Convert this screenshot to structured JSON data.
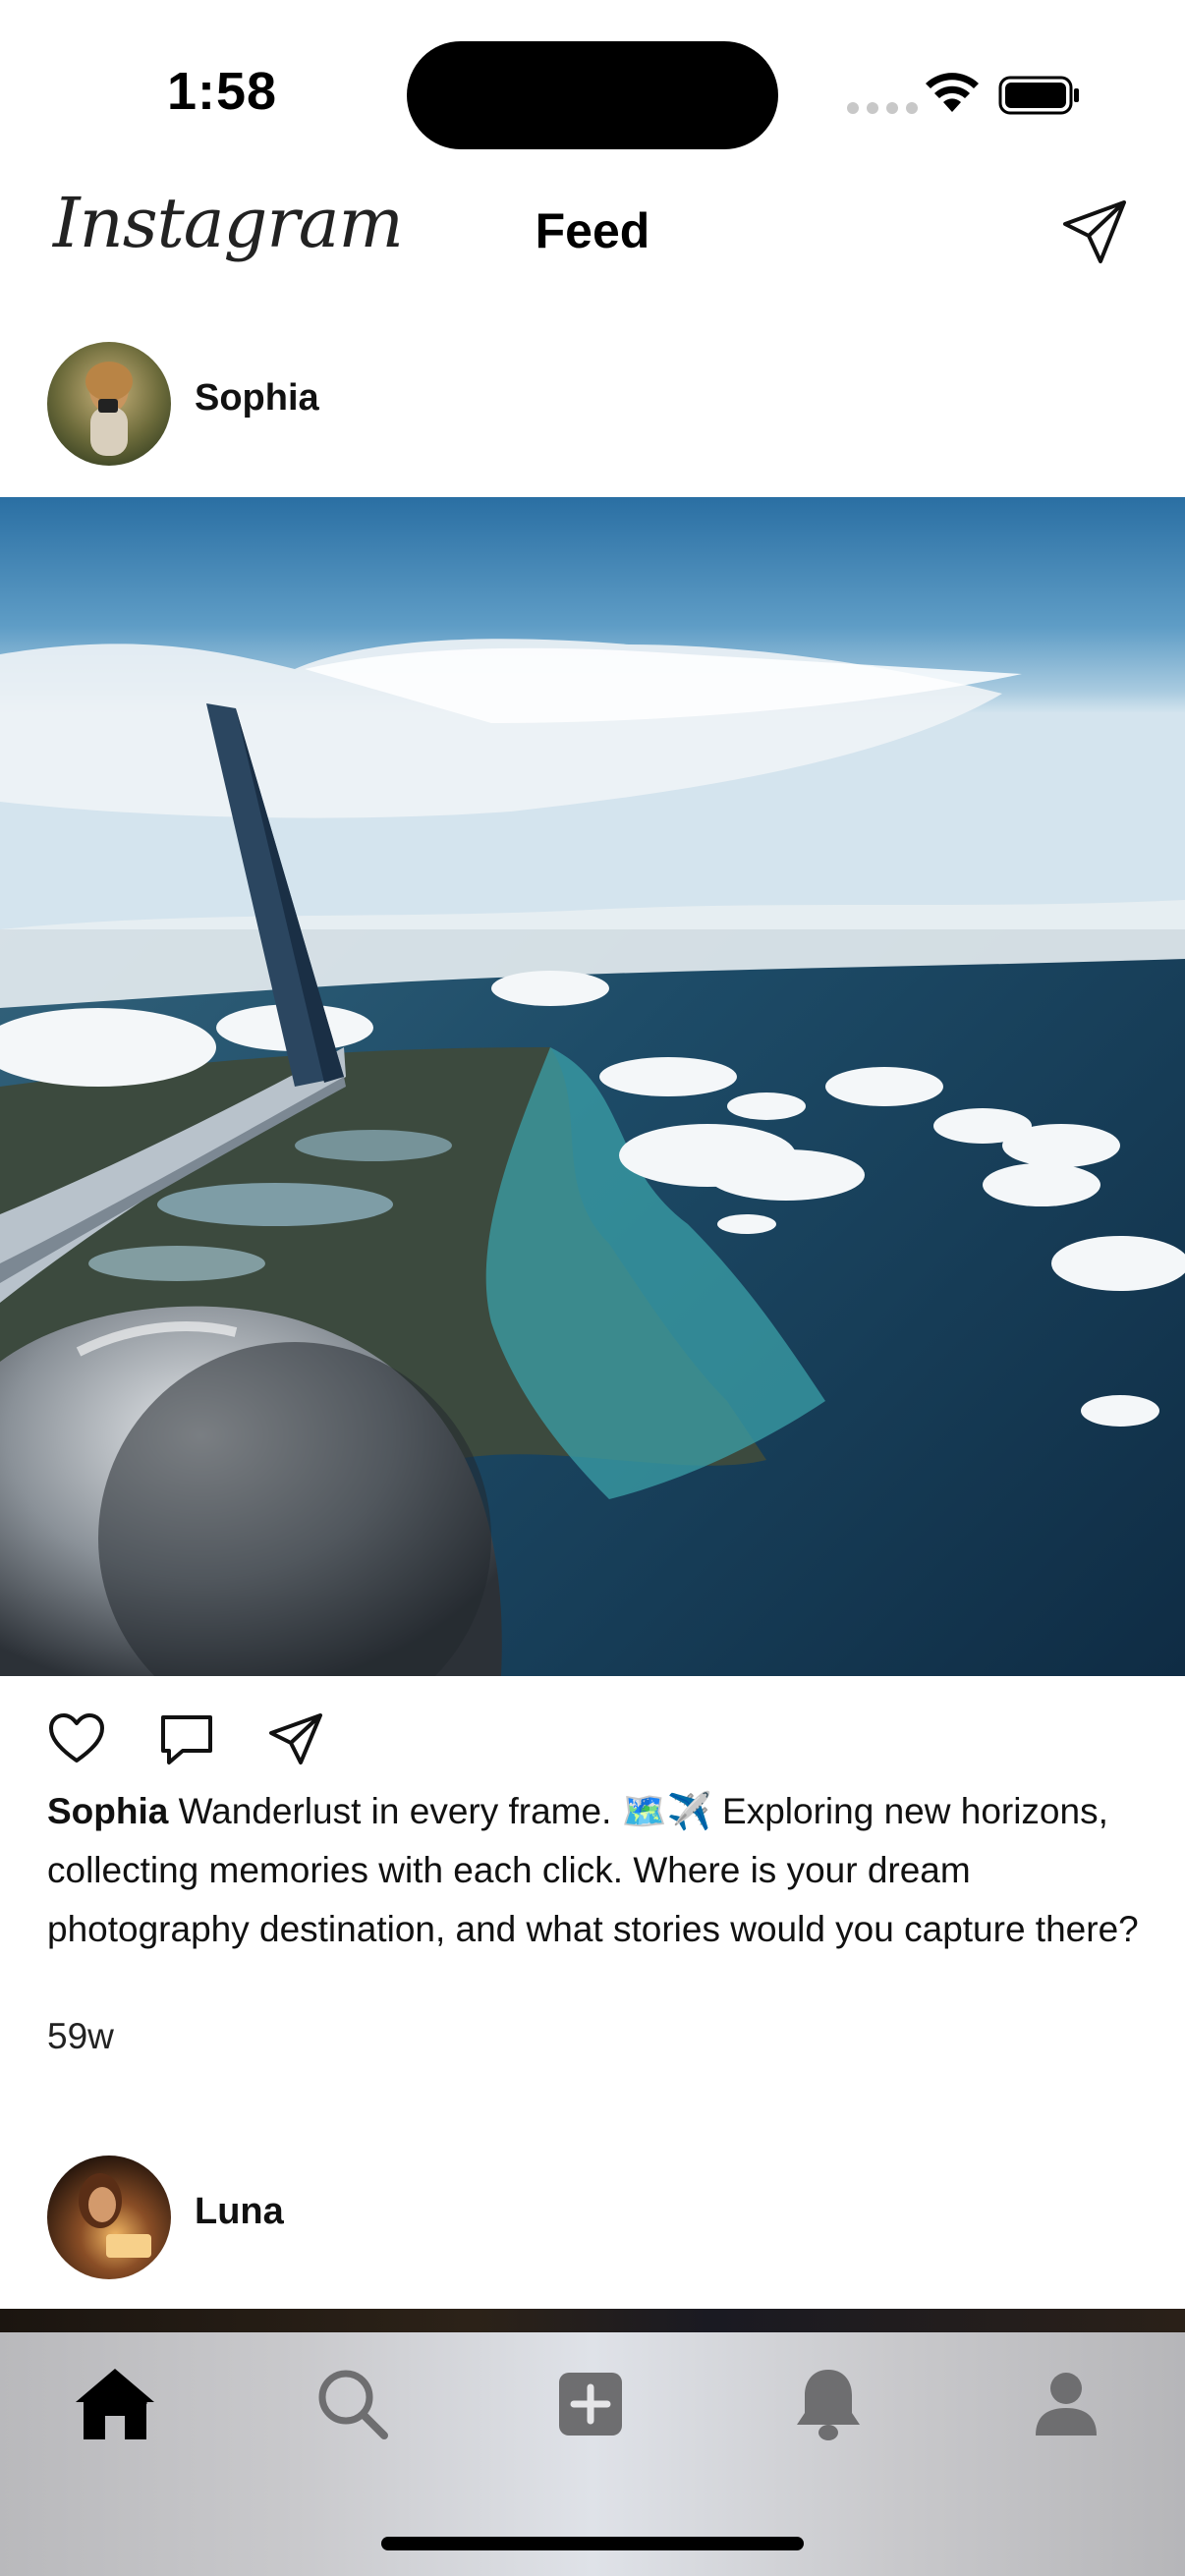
{
  "status_bar": {
    "time": "1:58"
  },
  "header": {
    "logo": "Instagram",
    "title": "Feed"
  },
  "posts": [
    {
      "username": "Sophia",
      "caption_username": "Sophia",
      "caption_text": "Wanderlust in every frame. 🗺️✈️ Exploring new horizons, collecting memories with each click. Where is your dream photography destination, and what stories would you capture there?",
      "time_ago": "59w"
    },
    {
      "username": "Luna"
    }
  ],
  "tabs": [
    {
      "name": "home",
      "icon": "home-icon",
      "active": true
    },
    {
      "name": "search",
      "icon": "search-icon",
      "active": false
    },
    {
      "name": "create",
      "icon": "add-square-icon",
      "active": false
    },
    {
      "name": "notifications",
      "icon": "bell-icon",
      "active": false
    },
    {
      "name": "profile",
      "icon": "person-icon",
      "active": false
    }
  ],
  "colors": {
    "active_tab": "#000000",
    "inactive_tab": "#6e6e70",
    "text": "#111111"
  }
}
